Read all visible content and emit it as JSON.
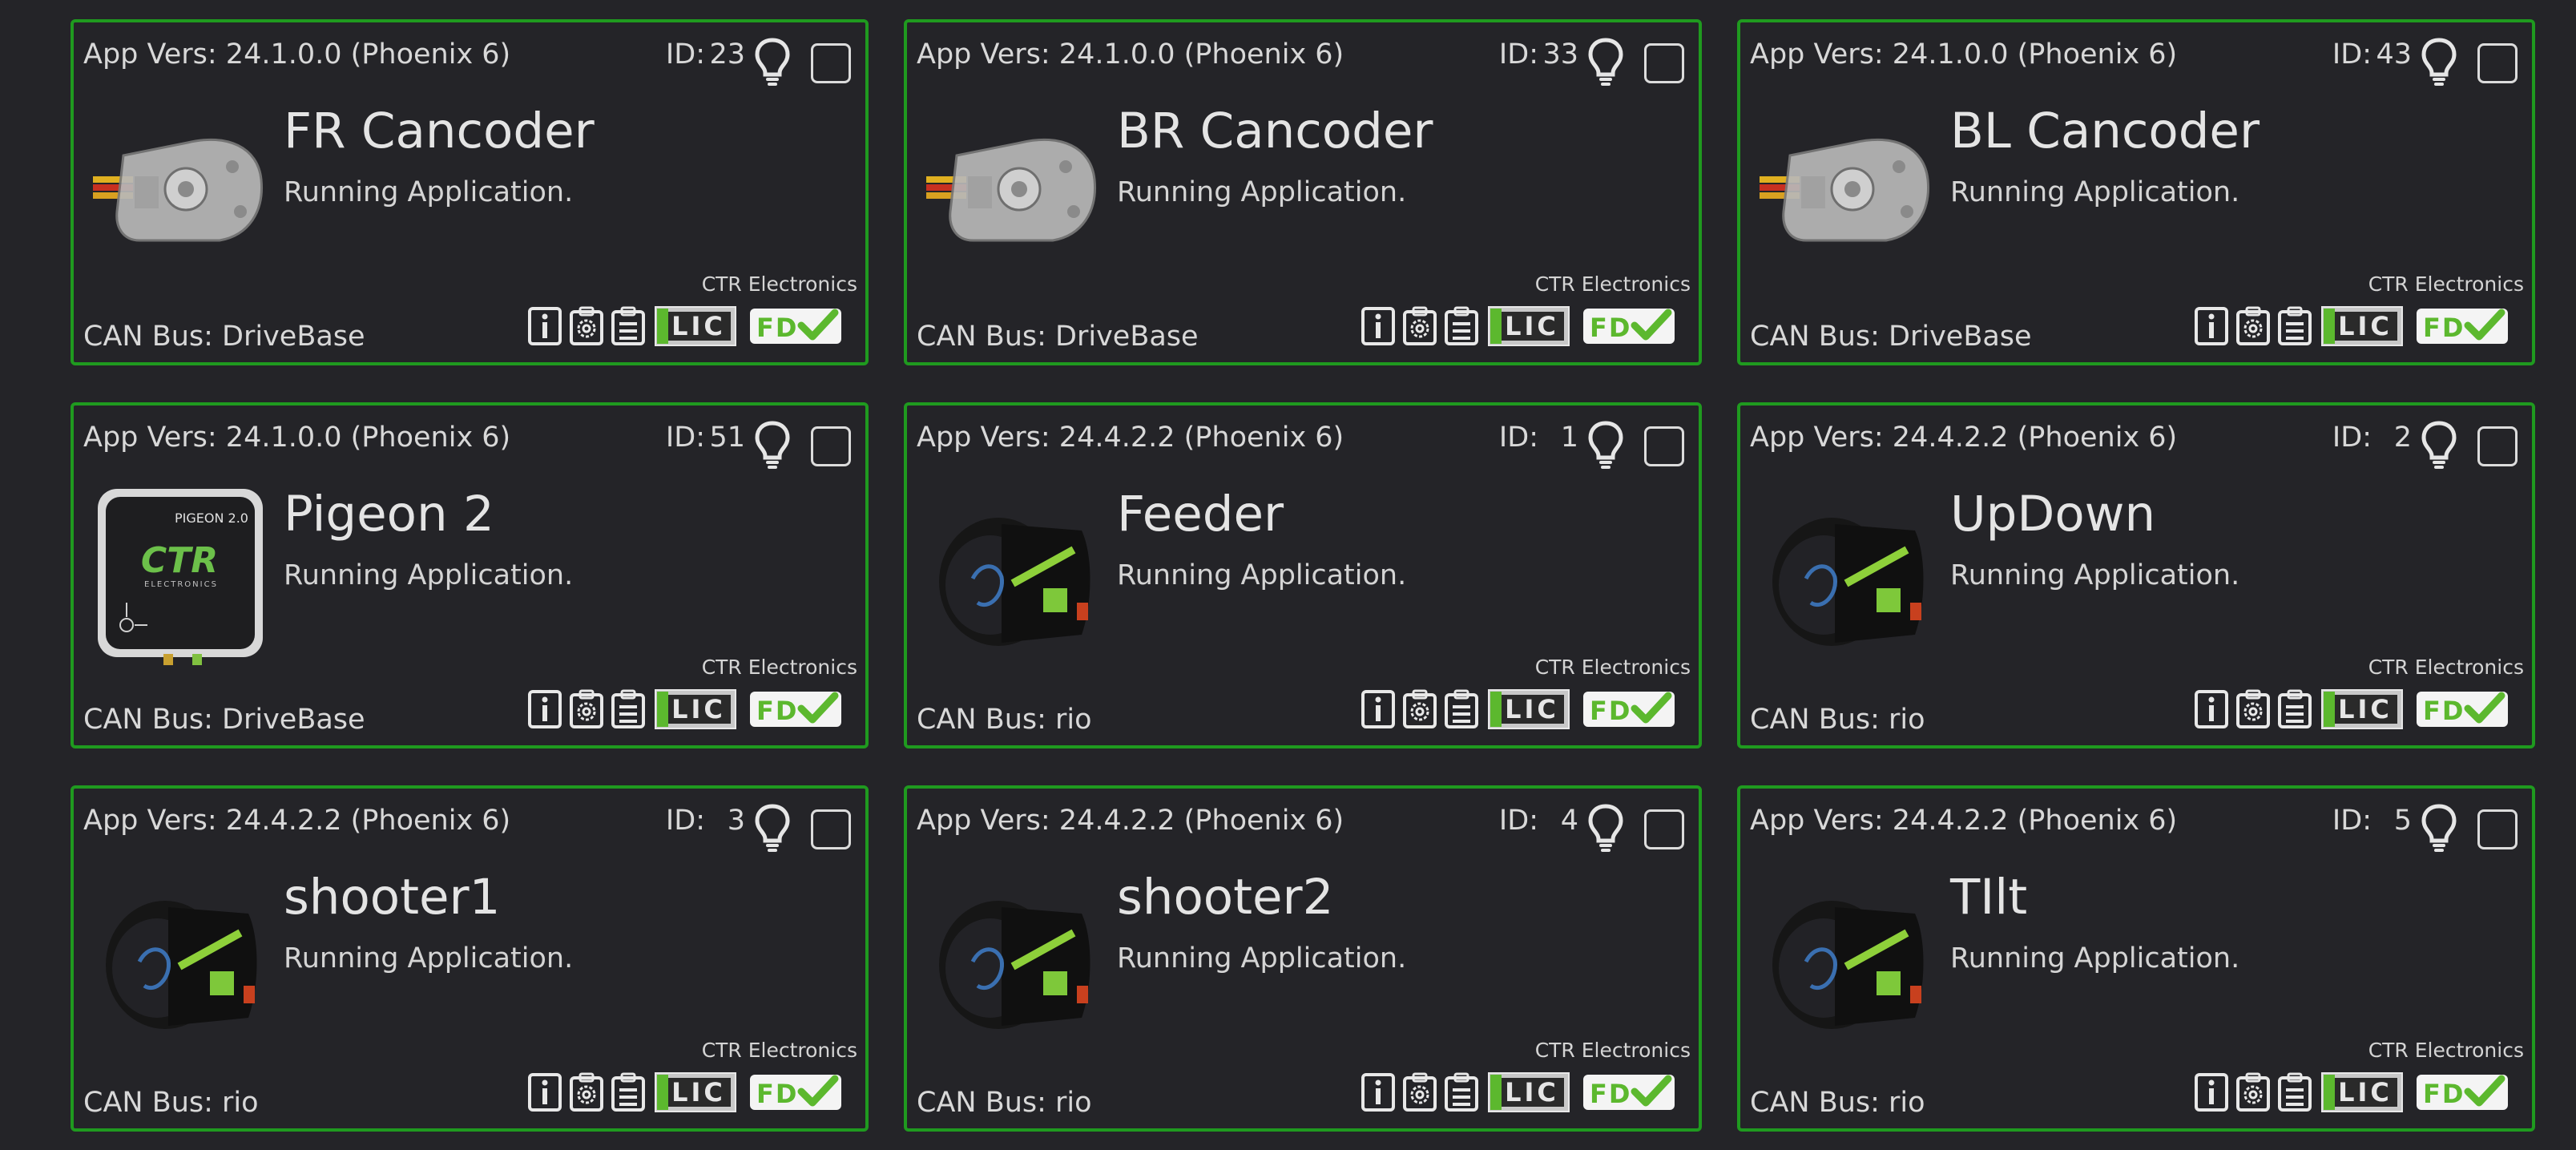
{
  "devices": [
    {
      "app_vers": "App Vers: 24.1.0.0 (Phoenix 6)",
      "id_label": "ID:",
      "id": "23",
      "name": "FR Cancoder",
      "status": "Running Application.",
      "vendor": "CTR Electronics",
      "can_bus": "CAN Bus: DriveBase",
      "image": "cancoder"
    },
    {
      "app_vers": "App Vers: 24.1.0.0 (Phoenix 6)",
      "id_label": "ID:",
      "id": "33",
      "name": "BR Cancoder",
      "status": "Running Application.",
      "vendor": "CTR Electronics",
      "can_bus": "CAN Bus: DriveBase",
      "image": "cancoder"
    },
    {
      "app_vers": "App Vers: 24.1.0.0 (Phoenix 6)",
      "id_label": "ID:",
      "id": "43",
      "name": "BL Cancoder",
      "status": "Running Application.",
      "vendor": "CTR Electronics",
      "can_bus": "CAN Bus: DriveBase",
      "image": "cancoder"
    },
    {
      "app_vers": "App Vers: 24.1.0.0 (Phoenix 6)",
      "id_label": "ID:",
      "id": "51",
      "name": "Pigeon 2",
      "status": "Running Application.",
      "vendor": "CTR Electronics",
      "can_bus": "CAN Bus: DriveBase",
      "image": "pigeon",
      "image_text": "PIGEON 2.0",
      "image_logo": "CTR",
      "image_logo_sub": "ELECTRONICS"
    },
    {
      "app_vers": "App Vers: 24.4.2.2 (Phoenix 6)",
      "id_label": "ID:",
      "id": "1",
      "name": "Feeder",
      "status": "Running Application.",
      "vendor": "CTR Electronics",
      "can_bus": "CAN Bus: rio",
      "image": "talonfx"
    },
    {
      "app_vers": "App Vers: 24.4.2.2 (Phoenix 6)",
      "id_label": "ID:",
      "id": "2",
      "name": "UpDown",
      "status": "Running Application.",
      "vendor": "CTR Electronics",
      "can_bus": "CAN Bus: rio",
      "image": "talonfx"
    },
    {
      "app_vers": "App Vers: 24.4.2.2 (Phoenix 6)",
      "id_label": "ID:",
      "id": "3",
      "name": "shooter1",
      "status": "Running Application.",
      "vendor": "CTR Electronics",
      "can_bus": "CAN Bus: rio",
      "image": "talonfx"
    },
    {
      "app_vers": "App Vers: 24.4.2.2 (Phoenix 6)",
      "id_label": "ID:",
      "id": "4",
      "name": "shooter2",
      "status": "Running Application.",
      "vendor": "CTR Electronics",
      "can_bus": "CAN Bus: rio",
      "image": "talonfx"
    },
    {
      "app_vers": "App Vers: 24.4.2.2 (Phoenix 6)",
      "id_label": "ID:",
      "id": "5",
      "name": "TIlt",
      "status": "Running Application.",
      "vendor": "CTR Electronics",
      "can_bus": "CAN Bus: rio",
      "image": "talonfx"
    }
  ],
  "toolbar_buttons": [
    {
      "name": "info-icon",
      "kind": "info"
    },
    {
      "name": "config-gear-icon",
      "kind": "config"
    },
    {
      "name": "details-clipboard-icon",
      "kind": "clipboard"
    },
    {
      "name": "license-lic-icon",
      "kind": "lic",
      "text": "LIC"
    },
    {
      "name": "fd-license-valid-icon",
      "kind": "fd",
      "text": "FD"
    }
  ],
  "colors": {
    "background": "#242428",
    "card_border": "#1f9a1f",
    "text": "#d8d8d8",
    "license_green": "#5cb82e"
  }
}
